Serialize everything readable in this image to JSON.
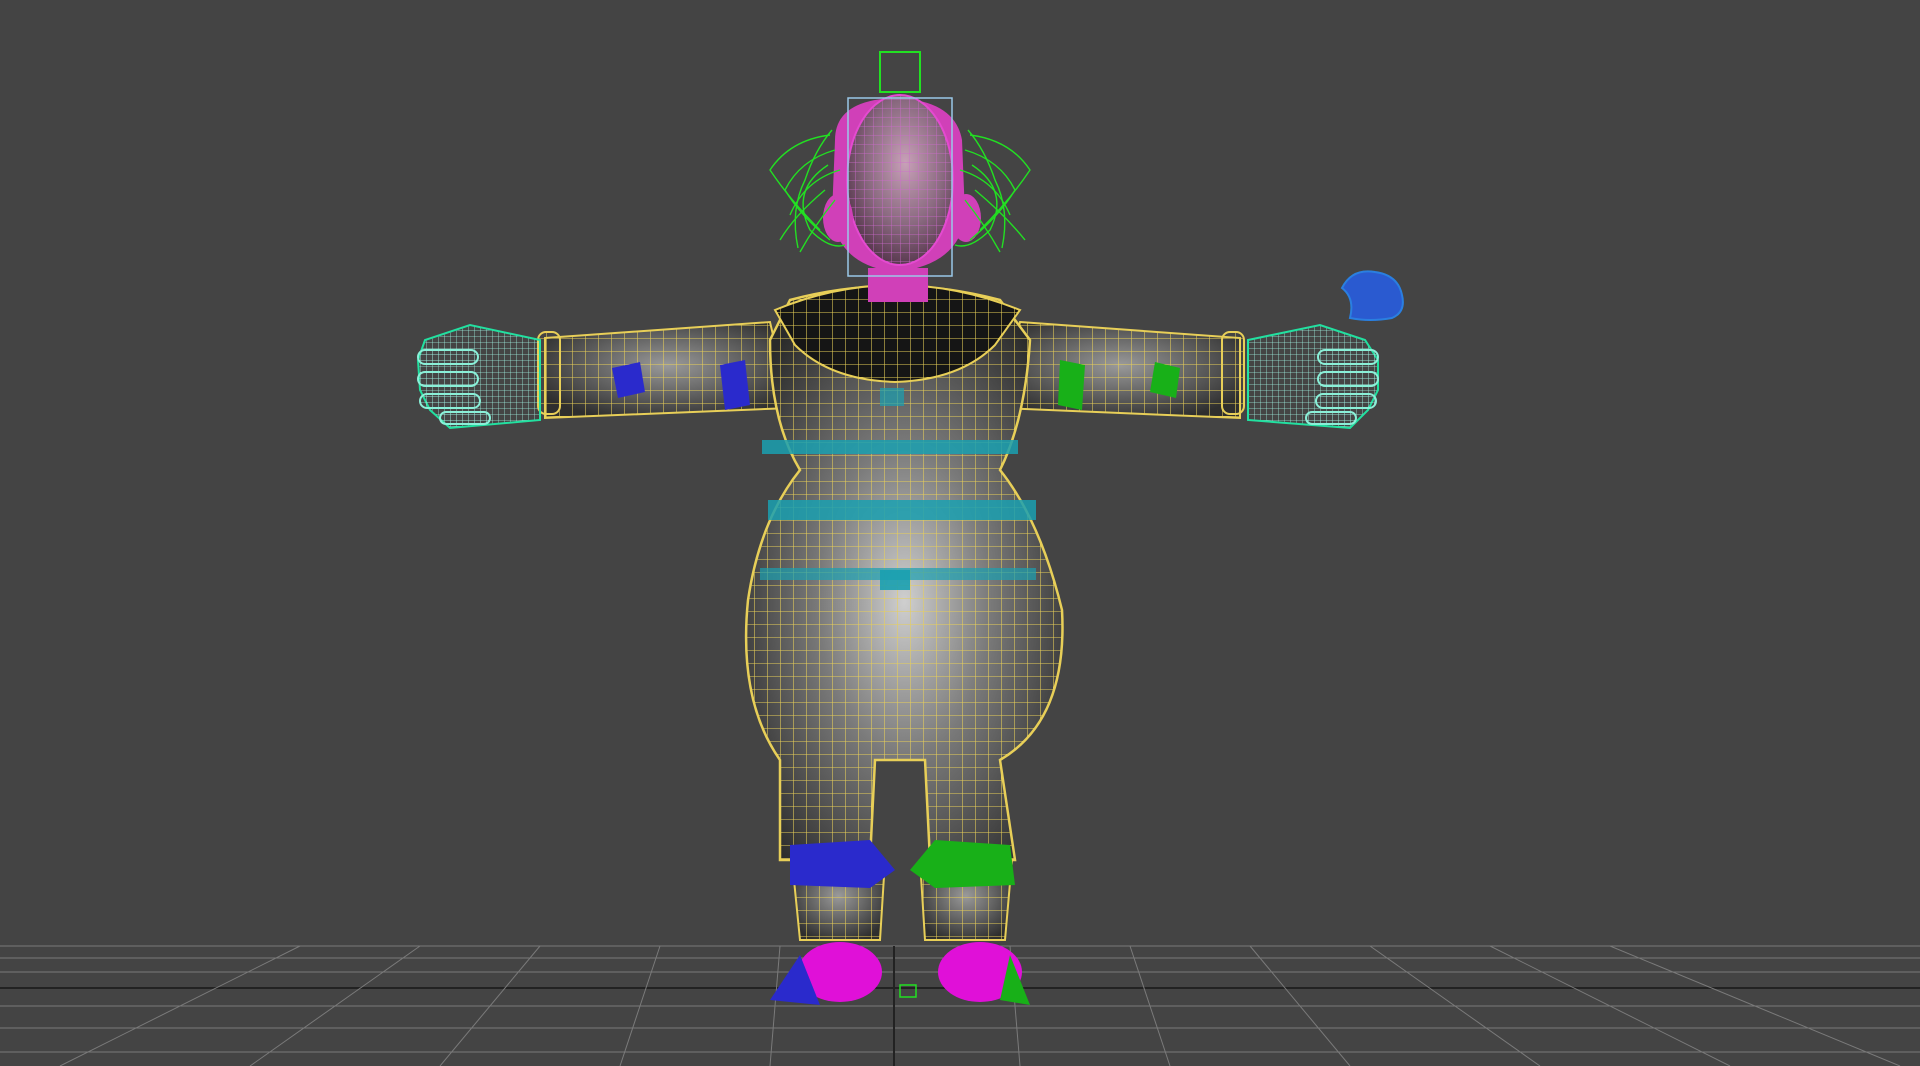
{
  "viewport": {
    "background": "#444444",
    "grid_color": "#7a7a7a",
    "mesh_wire_color": "#e8cf58",
    "controls": {
      "head_color": "#e040c8",
      "hair_color": "#22e022",
      "left_side_color": "#2a2acc",
      "right_side_color": "#18b018",
      "center_color": "#1aa0b0",
      "hand_color": "#8af0d8",
      "gizmo_color": "#2a7fe0",
      "head_box_color": "#9ac8e8"
    }
  }
}
